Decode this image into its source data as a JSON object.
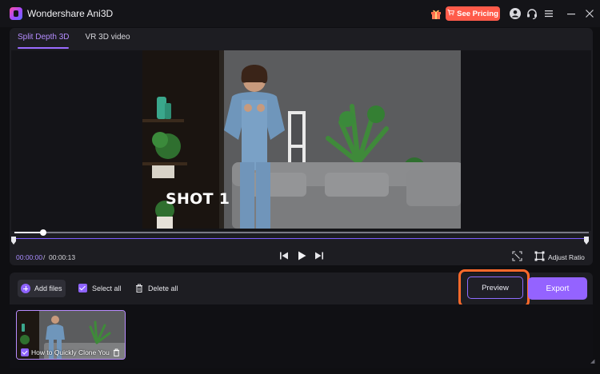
{
  "app": {
    "title": "Wondershare Ani3D"
  },
  "titlebar": {
    "pricing_label": "See Pricing",
    "pricing_color": "#ff5b4a",
    "icons": [
      "gift-icon",
      "cart-icon",
      "user-icon",
      "headset-icon",
      "menu-icon",
      "minimize-icon",
      "close-icon"
    ]
  },
  "tabs": [
    {
      "label": "Split Depth 3D",
      "active": true
    },
    {
      "label": "VR 3D video",
      "active": false
    }
  ],
  "video": {
    "overlay_text": "SHOT 1",
    "time_current": "00:00:00",
    "time_separator": "/",
    "time_total": "00:00:13",
    "playhead_fraction": 0.05
  },
  "controls": {
    "adjust_ratio_label": "Adjust Ratio"
  },
  "toolbar": {
    "add_files_label": "Add files",
    "select_all_label": "Select all",
    "delete_all_label": "Delete all",
    "preview_label": "Preview",
    "export_label": "Export",
    "accent_color": "#9463ff",
    "highlight_color": "#ff6a2b"
  },
  "media": {
    "items": [
      {
        "name": "How to Quickly Clone You",
        "checked": true
      }
    ]
  }
}
